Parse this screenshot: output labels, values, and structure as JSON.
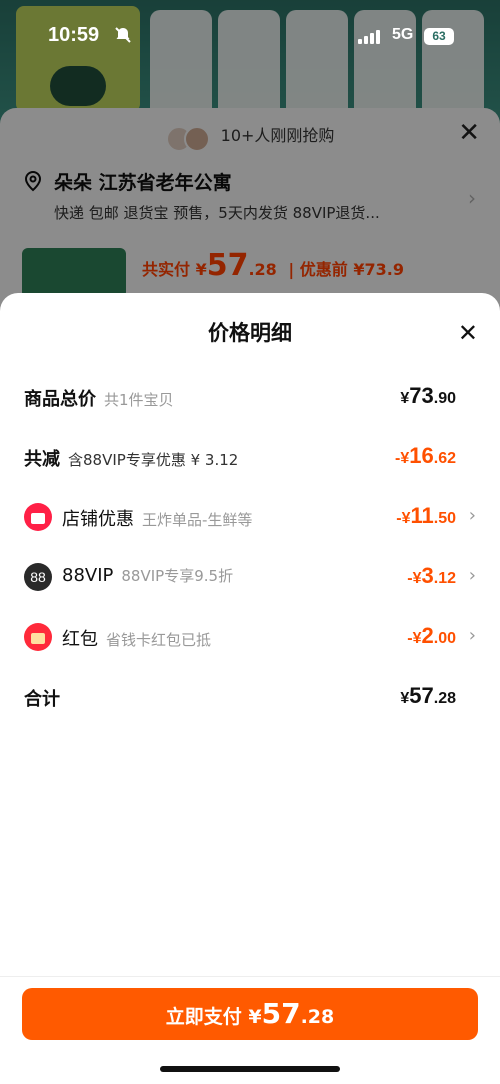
{
  "status_bar": {
    "time": "10:59",
    "network": "5G",
    "battery": "63"
  },
  "background_product": {
    "bottle_texts": [
      "",
      "",
      "",
      "",
      ""
    ],
    "grab_text": "10+人刚刚抢购",
    "address": "朵朵 江苏省老年公寓",
    "services": "快递 包邮 退货宝 预售，5天内发货 88VIP退货...",
    "actual_pay_label": "共实付 ¥",
    "actual_pay_int": "57",
    "actual_pay_dec": ".28",
    "before_discount": "| 优惠前 ¥73.9"
  },
  "sheet": {
    "title": "价格明细",
    "rows": [
      {
        "label": "商品总价",
        "sub": "共1件宝贝",
        "amt_prefix": "¥",
        "amt_int": "73",
        "amt_dec": ".90"
      },
      {
        "label": "共减",
        "sub": "含88VIP专享优惠 ¥ 3.12",
        "amt_prefix": "-¥",
        "amt_int": "16",
        "amt_dec": ".62"
      },
      {
        "label": "店铺优惠",
        "sub": "王炸单品-生鲜等",
        "amt_prefix": "-¥",
        "amt_int": "11",
        "amt_dec": ".50"
      },
      {
        "label": "88VIP",
        "sub": "88VIP专享9.5折",
        "amt_prefix": "-¥",
        "amt_int": "3",
        "amt_dec": ".12"
      },
      {
        "label": "红包",
        "sub": "省钱卡红包已抵",
        "amt_prefix": "-¥",
        "amt_int": "2",
        "amt_dec": ".00"
      },
      {
        "label": "合计",
        "sub": "",
        "amt_prefix": "¥",
        "amt_int": "57",
        "amt_dec": ".28"
      }
    ],
    "vip_icon_text": "88",
    "pay_button": {
      "label": "立即支付 ¥",
      "int": "57",
      "dec": ".28"
    }
  },
  "colors": {
    "accent": "#ff5a00",
    "discount": "#ff5000",
    "store_icon": "#ff2046"
  }
}
